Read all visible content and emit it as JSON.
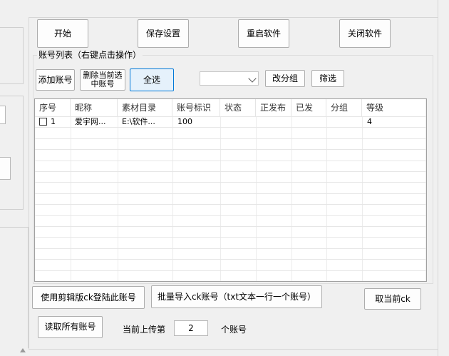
{
  "toolbar": {
    "start": "开始",
    "save_settings": "保存设置",
    "restart": "重启软件",
    "close": "关闭软件"
  },
  "account_group": {
    "title": "账号列表（右键点击操作）",
    "add_account": "添加账号",
    "delete_selected_line1": "删除当前选",
    "delete_selected_line2": "中账号",
    "select_all": "全选",
    "group_select_value": "",
    "change_group": "改分组",
    "filter": "筛选"
  },
  "table": {
    "columns": [
      "序号",
      "昵称",
      "素材目录",
      "账号标识",
      "状态",
      "正发布",
      "已发",
      "分组",
      "等级"
    ],
    "rows": [
      {
        "index": "1",
        "nickname": "爱宇网...",
        "material_dir": "E:\\软件...",
        "account_id": "100",
        "status": "",
        "publishing": "",
        "published": "",
        "group": "",
        "level": "4",
        "checked": false
      }
    ]
  },
  "footer": {
    "clipboard_login": "使用剪辑版ck登陆此账号",
    "batch_import": "批量导入ck账号（txt文本一行一个账号）",
    "cancel_ck": "取当前ck",
    "read_all": "读取所有账号",
    "upload_prefix": "当前上传第",
    "upload_value": "2",
    "upload_suffix": "个账号"
  }
}
